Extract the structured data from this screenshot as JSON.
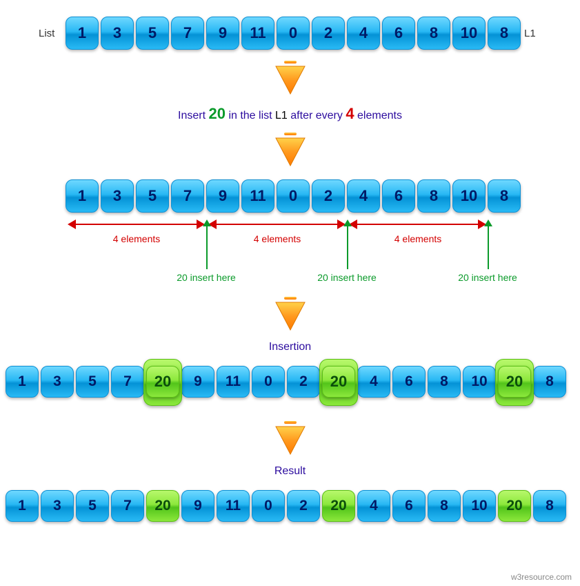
{
  "labels": {
    "list": "List",
    "l1": "L1",
    "insertion": "Insertion",
    "result": "Result",
    "watermark": "w3resource.com"
  },
  "caption": {
    "p1": "Insert",
    "val": "20",
    "p2": "in the list",
    "name": "L1",
    "p3": "after every",
    "count": "4",
    "p4": "elements"
  },
  "list1": [
    "1",
    "3",
    "5",
    "7",
    "9",
    "11",
    "0",
    "2",
    "4",
    "6",
    "8",
    "10",
    "8"
  ],
  "spans": {
    "label": "4 elements",
    "insert": "20 insert here"
  },
  "insertion_row": [
    {
      "v": "1",
      "t": "blue"
    },
    {
      "v": "3",
      "t": "blue"
    },
    {
      "v": "5",
      "t": "blue"
    },
    {
      "v": "7",
      "t": "blue"
    },
    {
      "v": "20",
      "t": "big"
    },
    {
      "v": "9",
      "t": "blue"
    },
    {
      "v": "11",
      "t": "blue"
    },
    {
      "v": "0",
      "t": "blue"
    },
    {
      "v": "2",
      "t": "blue"
    },
    {
      "v": "20",
      "t": "big"
    },
    {
      "v": "4",
      "t": "blue"
    },
    {
      "v": "6",
      "t": "blue"
    },
    {
      "v": "8",
      "t": "blue"
    },
    {
      "v": "10",
      "t": "blue"
    },
    {
      "v": "20",
      "t": "big"
    },
    {
      "v": "8",
      "t": "blue"
    }
  ],
  "result_row": [
    {
      "v": "1",
      "t": "blue"
    },
    {
      "v": "3",
      "t": "blue"
    },
    {
      "v": "5",
      "t": "blue"
    },
    {
      "v": "7",
      "t": "blue"
    },
    {
      "v": "20",
      "t": "green"
    },
    {
      "v": "9",
      "t": "blue"
    },
    {
      "v": "11",
      "t": "blue"
    },
    {
      "v": "0",
      "t": "blue"
    },
    {
      "v": "2",
      "t": "blue"
    },
    {
      "v": "20",
      "t": "green"
    },
    {
      "v": "4",
      "t": "blue"
    },
    {
      "v": "6",
      "t": "blue"
    },
    {
      "v": "8",
      "t": "blue"
    },
    {
      "v": "10",
      "t": "blue"
    },
    {
      "v": "20",
      "t": "green"
    },
    {
      "v": "8",
      "t": "blue"
    }
  ]
}
